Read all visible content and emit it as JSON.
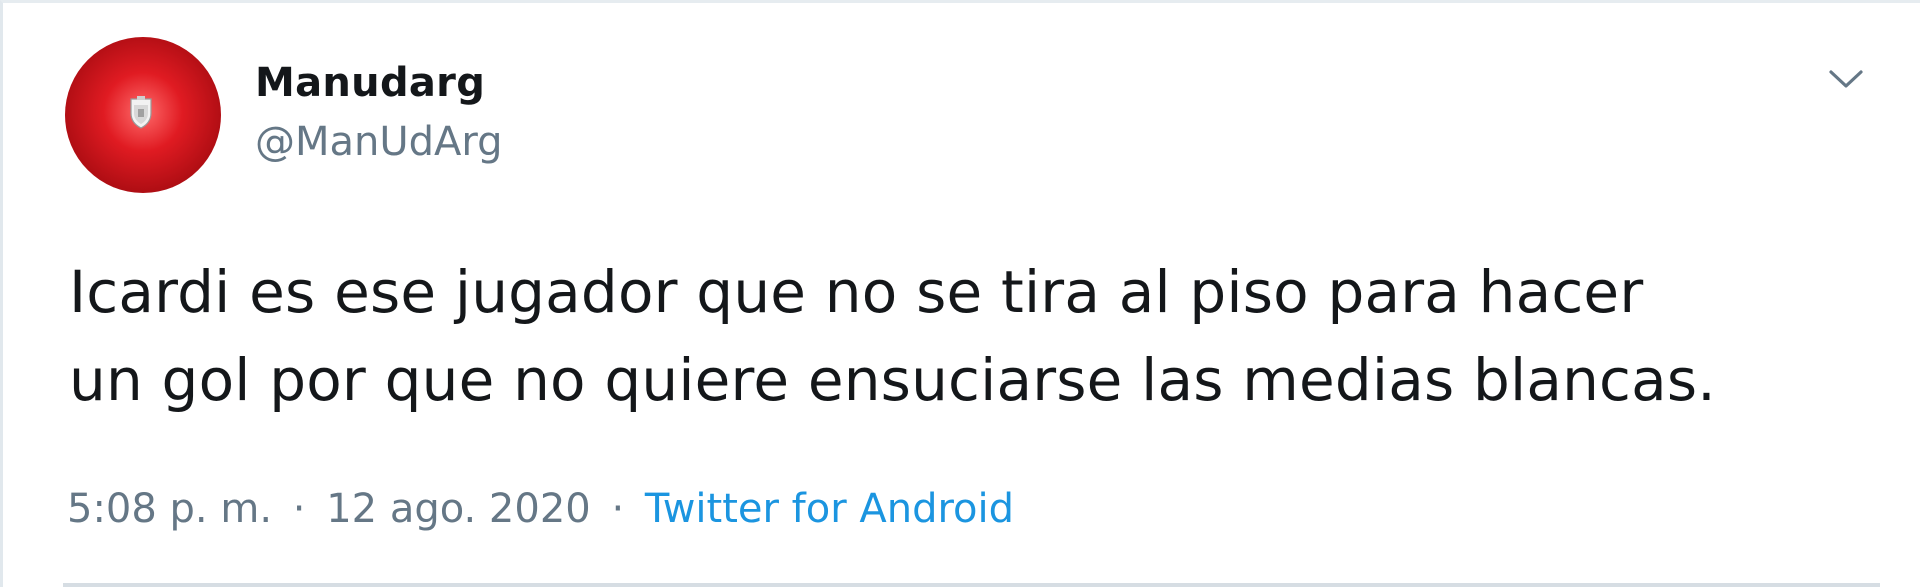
{
  "tweet": {
    "display_name": "Manudarg",
    "handle": "@ManUdArg",
    "text": "Icardi es ese jugador que no se tira al piso para hacer\nun gol por que no quiere ensuciarse las medias blancas.",
    "time": "5:08 p. m.",
    "separator": "·",
    "date": "12 ago. 2020",
    "source": "Twitter for Android"
  },
  "icons": {
    "menu": "chevron-down-icon",
    "avatar": "manchester-united-crest"
  },
  "colors": {
    "text": "#14171a",
    "secondary": "#657786",
    "link": "#1b95e0",
    "avatar_red": "#e01b22"
  }
}
